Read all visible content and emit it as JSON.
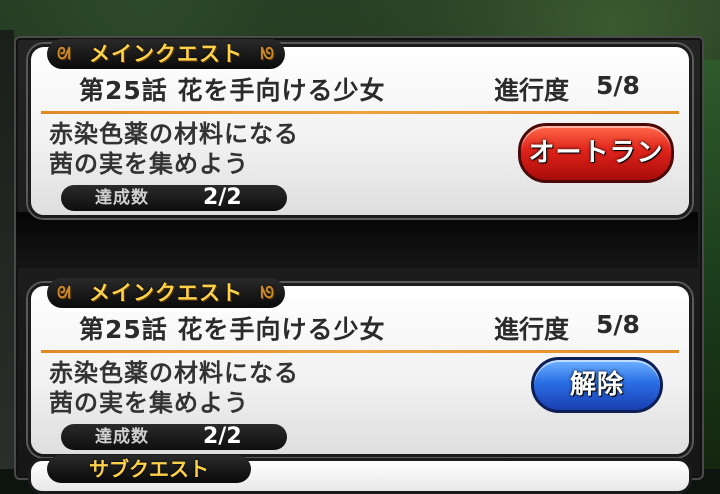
{
  "quests": [
    {
      "tag": "メインクエスト",
      "chapter": "第25話  花を手向ける少女",
      "progress_label": "進行度",
      "progress_value": "5/8",
      "description_line1": "赤染色薬の材料になる",
      "description_line2": "茜の実を集めよう",
      "count_label": "達成数",
      "count_value": "2/2",
      "button_label": "オートラン",
      "button_color": "#e0231a"
    },
    {
      "tag": "メインクエスト",
      "chapter": "第25話  花を手向ける少女",
      "progress_label": "進行度",
      "progress_value": "5/8",
      "description_line1": "赤染色薬の材料になる",
      "description_line2": "茜の実を集めよう",
      "count_label": "達成数",
      "count_value": "2/2",
      "button_label": "解除",
      "button_color": "#2a6ee6"
    }
  ],
  "next_quest": {
    "tag": "サブクエスト"
  },
  "colors": {
    "tag_text": "#ffd24a",
    "divider": "#e08a22"
  }
}
